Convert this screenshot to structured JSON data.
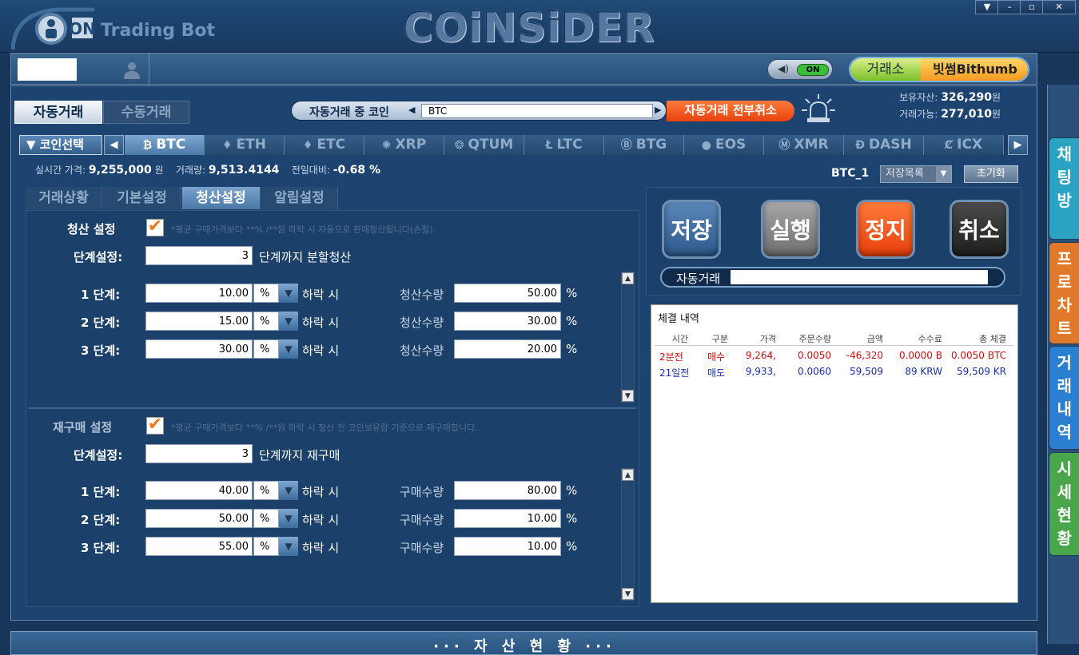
{
  "window": {
    "brand_sub": "Trading Bot",
    "brand_main": "COiNSiDER",
    "logo_text": "ON",
    "controls": [
      "▼",
      "–",
      "▫",
      "✕"
    ]
  },
  "toolbar": {
    "sound_state": "ON",
    "exchange_label": "거래소",
    "exchange_value": "빗썸Bithumb"
  },
  "mode_tabs": [
    {
      "label": "자동거래",
      "active": true
    },
    {
      "label": "수동거래",
      "active": false
    }
  ],
  "trading_coin": {
    "label": "자동거래 중 코인",
    "value": "BTC",
    "cancel_all": "자동거래 전부취소"
  },
  "assets": {
    "holding_label": "보유자산:",
    "holding_value": "326,290",
    "available_label": "거래가능:",
    "available_value": "277,010",
    "unit": "원"
  },
  "coin_select": {
    "label": "▼ 코인선택",
    "coins": [
      {
        "symbol": "₿",
        "label": "BTC",
        "active": true
      },
      {
        "symbol": "♦",
        "label": "ETH",
        "active": false
      },
      {
        "symbol": "♦",
        "label": "ETC",
        "active": false
      },
      {
        "symbol": "✺",
        "label": "XRP",
        "active": false
      },
      {
        "symbol": "❂",
        "label": "QTUM",
        "active": false
      },
      {
        "symbol": "Ł",
        "label": "LTC",
        "active": false
      },
      {
        "symbol": "Ⓑ",
        "label": "BTG",
        "active": false
      },
      {
        "symbol": "●",
        "label": "EOS",
        "active": false
      },
      {
        "symbol": "Ⓜ",
        "label": "XMR",
        "active": false
      },
      {
        "symbol": "Ð",
        "label": "DASH",
        "active": false
      },
      {
        "symbol": "Ȼ",
        "label": "ICX",
        "active": false
      }
    ]
  },
  "price_info": {
    "realtime_label": "실시간 가격:",
    "realtime_value": "9,255,000",
    "realtime_unit": "원",
    "volume_label": "거래량:",
    "volume_value": "9,513.4144",
    "change_label": "전일대비:",
    "change_value": "-0.68 %"
  },
  "preset": {
    "name": "BTC_1",
    "save_list": "저장목록",
    "reset": "초기화"
  },
  "settings_tabs": [
    {
      "label": "거래상황",
      "active": false
    },
    {
      "label": "기본설정",
      "active": false
    },
    {
      "label": "청산설정",
      "active": true
    },
    {
      "label": "알림설정",
      "active": false
    }
  ],
  "liquidation": {
    "title": "청산 설정",
    "note": "*평균 구매가격보다 **% /**원 하락 시 자동으로 판매청산됩니다(손절).",
    "steps_label": "단계설정:",
    "steps_value": "3",
    "steps_suffix": "단계까지 분할청산",
    "qty_label": "청산수량",
    "rows": [
      {
        "step": "1  단계:",
        "pct": "10.00",
        "unit": "%",
        "drop": "하락 시",
        "qty": "50.00",
        "qty_unit": "%"
      },
      {
        "step": "2  단계:",
        "pct": "15.00",
        "unit": "%",
        "drop": "하락 시",
        "qty": "30.00",
        "qty_unit": "%"
      },
      {
        "step": "3  단계:",
        "pct": "30.00",
        "unit": "%",
        "drop": "하락 시",
        "qty": "20.00",
        "qty_unit": "%"
      }
    ]
  },
  "rebuy": {
    "title": "재구매 설정",
    "note": "*평균 구매가격보다 **% /**원 하락 시 청산 전 코인보유량 기준으로 재구매합니다.",
    "steps_label": "단계설정:",
    "steps_value": "3",
    "steps_suffix": "단계까지 재구매",
    "qty_label": "구매수량",
    "rows": [
      {
        "step": "1  단계:",
        "pct": "40.00",
        "unit": "%",
        "drop": "하락 시",
        "qty": "80.00",
        "qty_unit": "%"
      },
      {
        "step": "2  단계:",
        "pct": "50.00",
        "unit": "%",
        "drop": "하락 시",
        "qty": "10.00",
        "qty_unit": "%"
      },
      {
        "step": "3  단계:",
        "pct": "55.00",
        "unit": "%",
        "drop": "하락 시",
        "qty": "10.00",
        "qty_unit": "%"
      }
    ]
  },
  "actions": {
    "save": "저장",
    "run": "실행",
    "stop": "정지",
    "cancel": "취소",
    "auto_trade_label": "자동거래"
  },
  "history": {
    "title": "체결 내역",
    "columns": [
      "시간",
      "구분",
      "가격",
      "주문수량",
      "금액",
      "수수료",
      "총 체결"
    ],
    "rows": [
      {
        "cells": [
          "2분전",
          "매수",
          "9,264,",
          "0.0050",
          "-46,320",
          "0.0000 B",
          "0.0050 BTC"
        ],
        "color": "#d01010"
      },
      {
        "cells": [
          "21일전",
          "매도",
          "9,933,",
          "0.0060",
          "59,509",
          "89 KRW",
          "59,509 KR"
        ],
        "color": "#1a2fb0"
      }
    ]
  },
  "side_tabs": [
    {
      "label": "채팅방",
      "color": "#2aa4c2"
    },
    {
      "label": "프로차트",
      "color": "#e07a2a"
    },
    {
      "label": "거래내역",
      "color": "#2a7fd0"
    },
    {
      "label": "시세현황",
      "color": "#4aa64a"
    }
  ],
  "bottom": {
    "title": "··· 자 산 현 황 ···"
  }
}
